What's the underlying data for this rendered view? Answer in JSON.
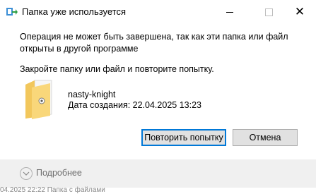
{
  "dialog": {
    "title": "Папка уже используется",
    "window_controls": {
      "minimize_icon": "minimize-icon",
      "maximize_icon": "maximize-icon",
      "close_icon": "close-icon"
    },
    "message_line1": "Операция не может быть завершена, так как эти папка или файл",
    "message_line2": "открыты в другой программе",
    "instruction": "Закройте папку или файл и повторите попытку.",
    "item": {
      "icon": "folder-icon",
      "name": "nasty-knight",
      "created": "Дата создания: 22.04.2025 13:23"
    },
    "buttons": {
      "retry": "Повторить попытку",
      "cancel": "Отмена"
    },
    "details": {
      "label": "Подробнее",
      "icon": "chevron-down-icon"
    },
    "accent_color": "#0078d7"
  },
  "background": {
    "partial_row": "04.2025 22:22      Папка с файлами"
  }
}
